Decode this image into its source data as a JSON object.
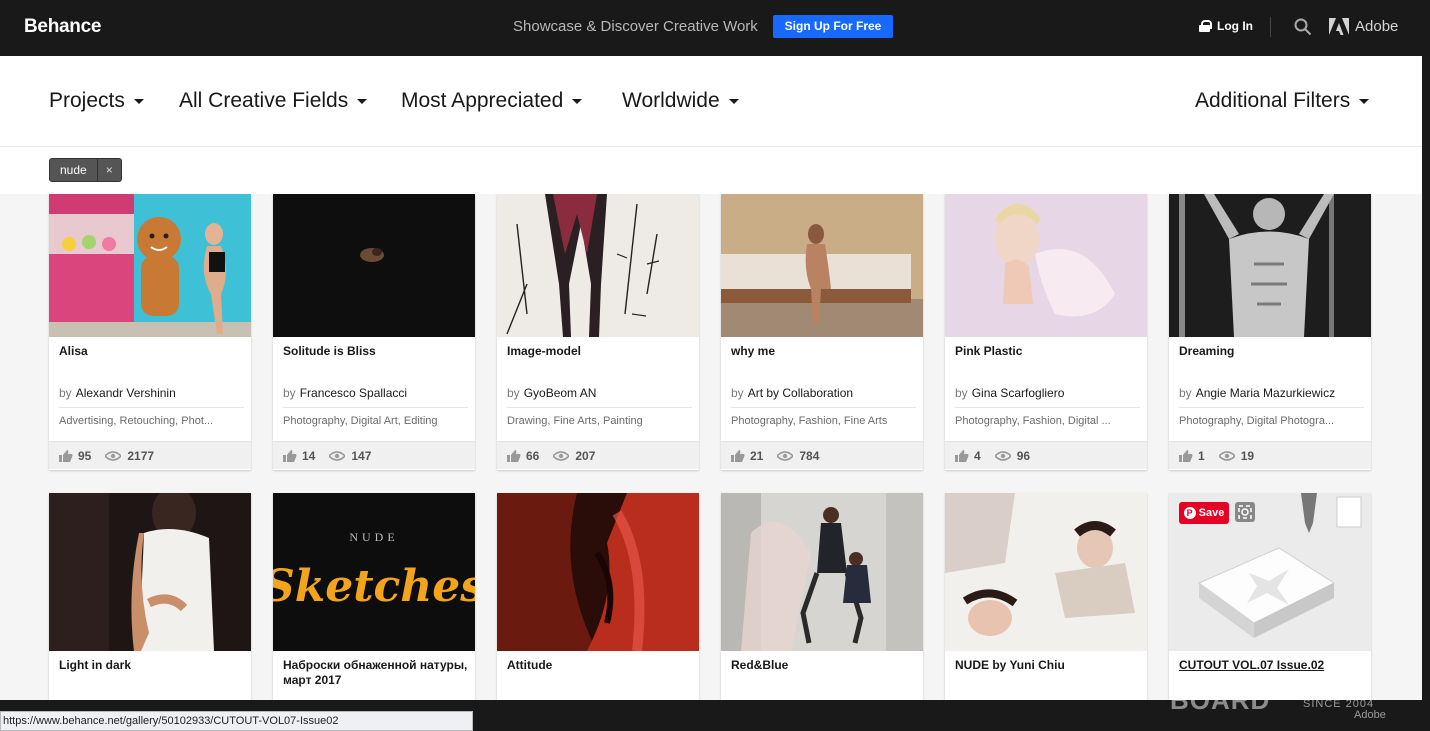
{
  "topbar": {
    "logo": "Behance",
    "tagline": "Showcase & Discover Creative Work",
    "signup_label": "Sign Up For Free",
    "login_label": "Log In",
    "adobe_label": "Adobe"
  },
  "filters": {
    "items": [
      "Projects",
      "All Creative Fields",
      "Most Appreciated",
      "Worldwide"
    ],
    "additional": "Additional Filters"
  },
  "tags": [
    {
      "label": "nude",
      "close": "×"
    }
  ],
  "projects": [
    {
      "title": "Alisa",
      "by": "by",
      "owner": "Alexandr Vershinin",
      "fields": "Advertising, Retouching, Phot...",
      "likes": "95",
      "views": "2177"
    },
    {
      "title": "Solitude is Bliss",
      "by": "by",
      "owner": "Francesco Spallacci",
      "fields": "Photography, Digital Art, Editing",
      "likes": "14",
      "views": "147"
    },
    {
      "title": "Image-model",
      "by": "by",
      "owner": "GyoBeom AN",
      "fields": "Drawing, Fine Arts, Painting",
      "likes": "66",
      "views": "207"
    },
    {
      "title": "why me",
      "by": "by",
      "owner": "Art by Collaboration",
      "fields": "Photography, Fashion, Fine Arts",
      "likes": "21",
      "views": "784"
    },
    {
      "title": "Pink Plastic",
      "by": "by",
      "owner": "Gina Scarfogliero",
      "fields": "Photography, Fashion, Digital ...",
      "likes": "4",
      "views": "96"
    },
    {
      "title": "Dreaming",
      "by": "by",
      "owner": "Angie Maria Mazurkiewicz",
      "fields": "Photography, Digital Photogra...",
      "likes": "1",
      "views": "19"
    },
    {
      "title": "Light in dark"
    },
    {
      "title": "Наброски обнаженной натуры, март 2017"
    },
    {
      "title": "Attitude"
    },
    {
      "title": "Red&Blue"
    },
    {
      "title": "NUDE by Yuni Chiu"
    },
    {
      "title": "CUTOUT VOL.07 Issue.02"
    }
  ],
  "pinterest": {
    "save_label": "Save",
    "logo": "P"
  },
  "thumb_texts": {
    "sketches_top": "NUDE",
    "sketches_main": "Sketches"
  },
  "status_url": "https://www.behance.net/gallery/50102933/CUTOUT-VOL07-Issue02",
  "watermark": {
    "main": "BOARD",
    "since": "SINCE 2004",
    "adobe": "Adobe"
  },
  "colors": {
    "accent": "#1769ff",
    "topbar": "#191919",
    "pinterest": "#e60023"
  }
}
